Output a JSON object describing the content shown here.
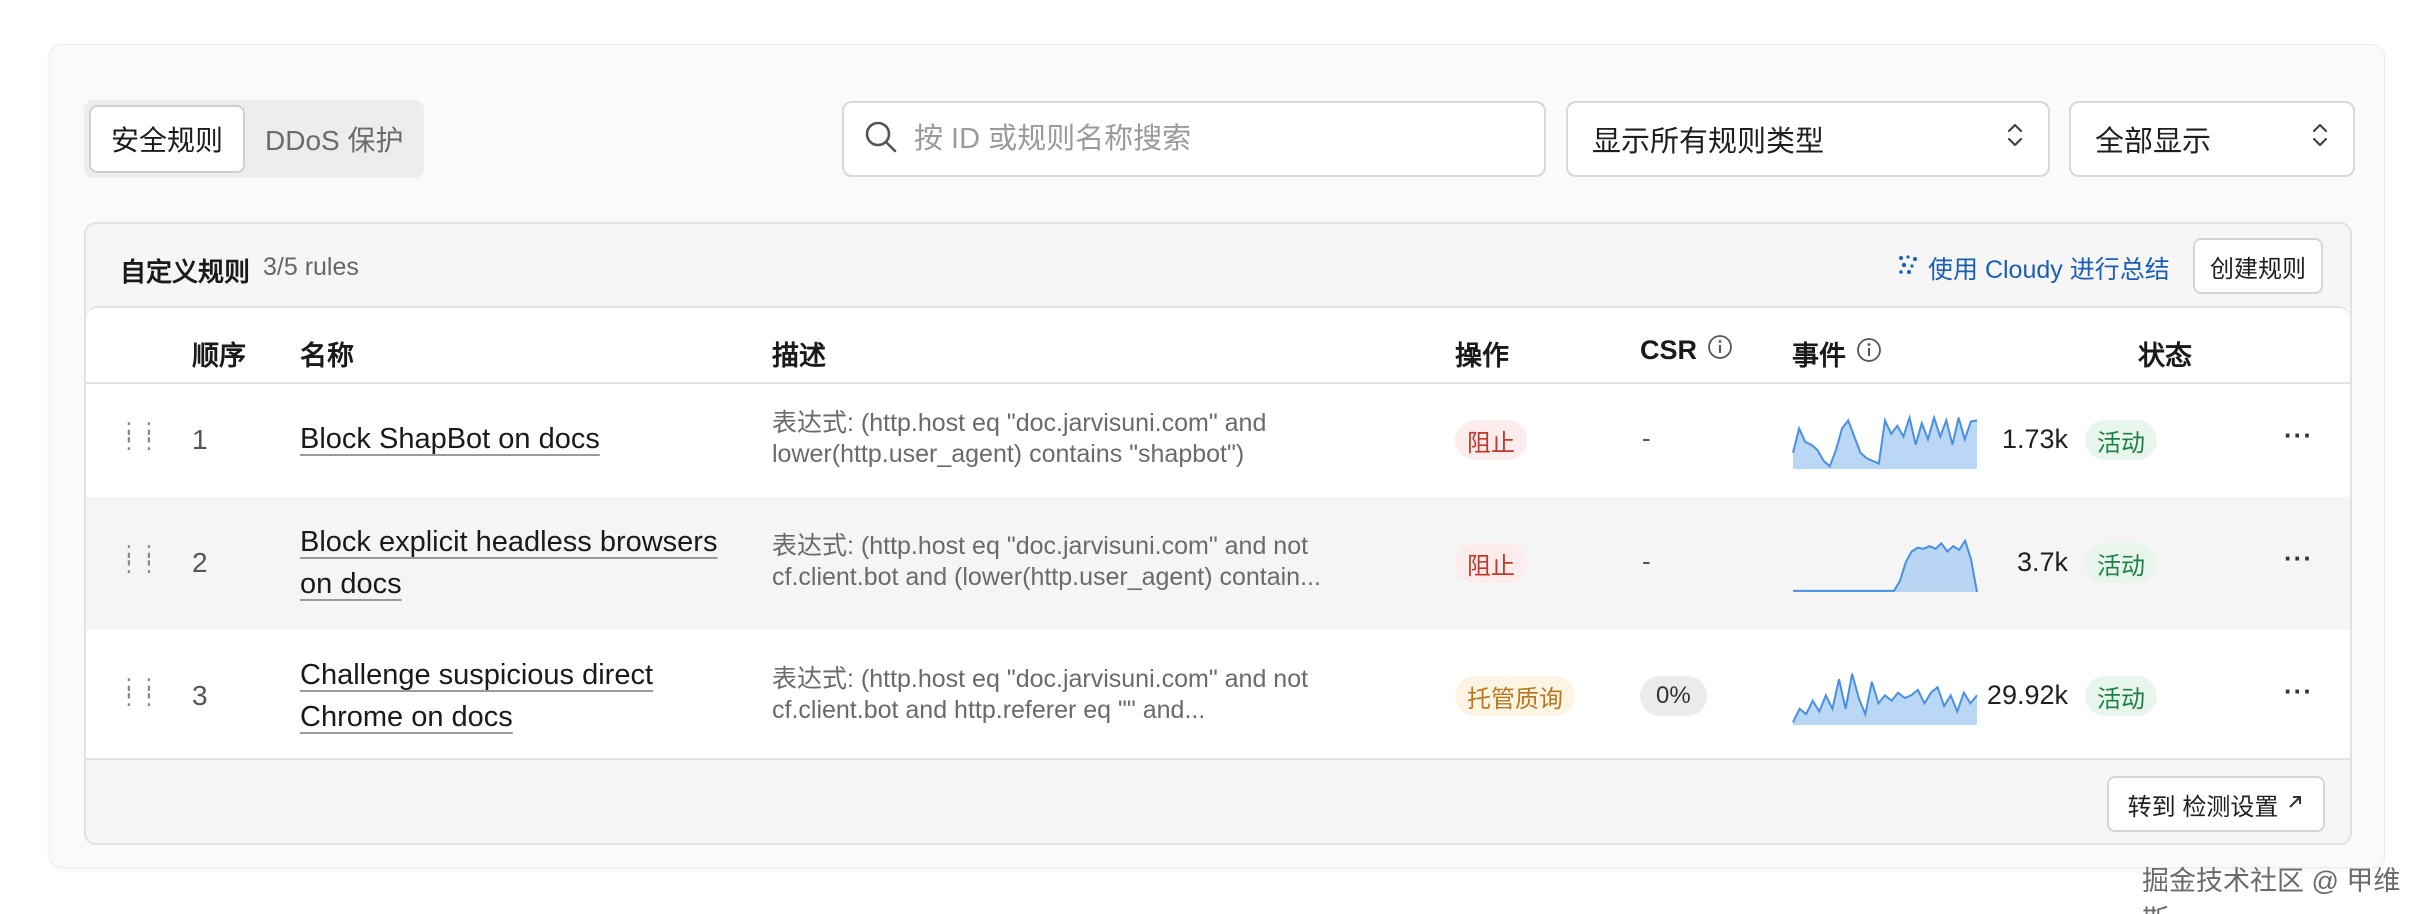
{
  "tabs": [
    {
      "label": "安全规则",
      "active": true
    },
    {
      "label": "DDoS 保护",
      "active": false
    }
  ],
  "search": {
    "placeholder": "按 ID 或规则名称搜索",
    "value": ""
  },
  "filters": {
    "rule_type": "显示所有规则类型",
    "display": "全部显示"
  },
  "panel": {
    "title": "自定义规则",
    "count": "3/5 rules",
    "cloudy_label": "使用 Cloudy 进行总结",
    "create_label": "创建规则",
    "goto_label": "转到 检测设置"
  },
  "columns": {
    "order": "顺序",
    "name": "名称",
    "desc": "描述",
    "action": "操作",
    "csr": "CSR",
    "events": "事件",
    "status": "状态"
  },
  "rules": [
    {
      "order": "1",
      "name": "Block ShapBot on docs",
      "desc": "表达式: (http.host eq \"doc.jarvisuni.com\" and lower(http.user_agent) contains \"shapbot\")",
      "action": "阻止",
      "csr": "-",
      "events": "1.73k",
      "status": "活动",
      "sparkline": [
        0.3,
        0.75,
        0.5,
        0.45,
        0.35,
        0.15,
        0.05,
        0.35,
        0.75,
        0.9,
        0.6,
        0.3,
        0.2,
        0.15,
        0.1,
        0.9,
        0.65,
        0.8,
        0.6,
        0.95,
        0.45,
        0.85,
        0.55,
        0.95,
        0.6,
        0.9,
        0.45,
        0.95,
        0.55,
        0.88,
        0.9
      ]
    },
    {
      "order": "2",
      "name": "Block explicit headless browsers on docs",
      "desc": "表达式: (http.host eq \"doc.jarvisuni.com\" and not cf.client.bot and (lower(http.user_agent) contain...",
      "action": "阻止",
      "csr": "-",
      "events": "3.7k",
      "status": "活动",
      "sparkline": [
        0.02,
        0.02,
        0.02,
        0.02,
        0.02,
        0.02,
        0.02,
        0.02,
        0.02,
        0.02,
        0.02,
        0.02,
        0.02,
        0.02,
        0.02,
        0.02,
        0.02,
        0.02,
        0.2,
        0.55,
        0.75,
        0.82,
        0.8,
        0.85,
        0.8,
        0.9,
        0.75,
        0.85,
        0.78,
        0.95,
        0.6,
        0.0
      ]
    },
    {
      "order": "3",
      "name": "Challenge suspicious direct Chrome on docs",
      "desc": "表达式: (http.host eq \"doc.jarvisuni.com\" and not cf.client.bot and http.referer eq \"\" and...",
      "action": "托管质询",
      "csr": "0%",
      "events": "29.92k",
      "status": "活动",
      "sparkline": [
        0.05,
        0.3,
        0.2,
        0.45,
        0.25,
        0.55,
        0.3,
        0.85,
        0.3,
        0.95,
        0.5,
        0.2,
        0.8,
        0.4,
        0.55,
        0.45,
        0.6,
        0.5,
        0.55,
        0.65,
        0.4,
        0.6,
        0.7,
        0.35,
        0.55,
        0.25,
        0.6,
        0.4,
        0.55
      ]
    }
  ],
  "watermark": "掘金技术社区 @ 甲维斯",
  "colors": {
    "spark_line": "#4a90e2",
    "spark_fill": "#a9cdf3",
    "accent": "#1a5fb4"
  }
}
